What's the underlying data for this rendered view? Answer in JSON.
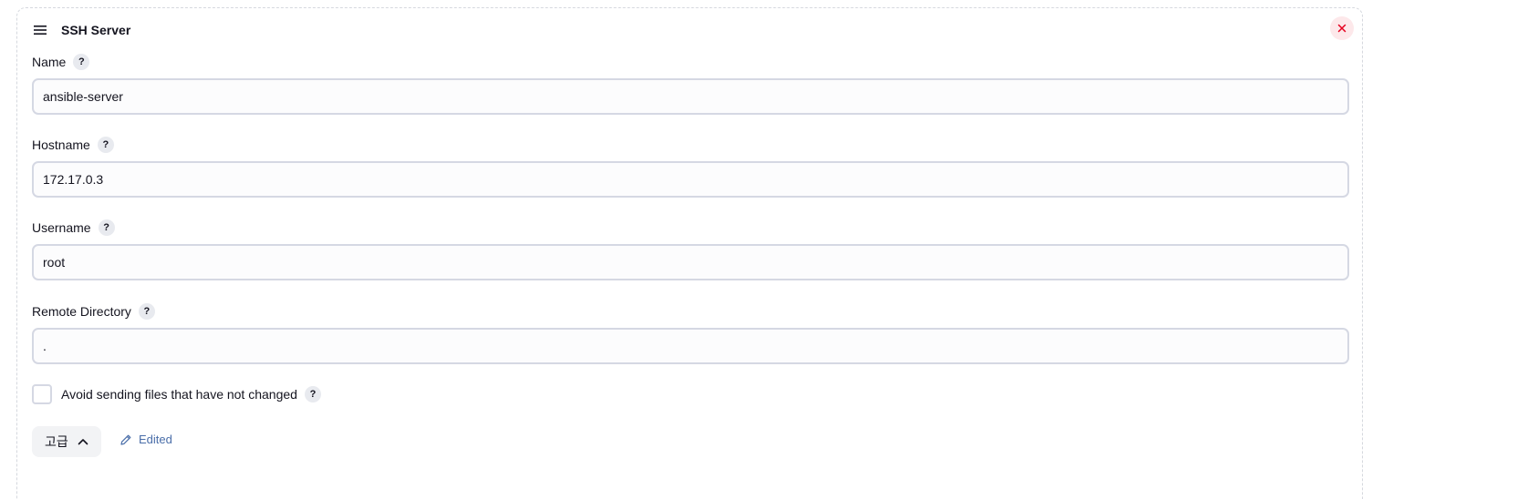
{
  "panel": {
    "title": "SSH Server",
    "handle_icon": "drag-handle-icon",
    "close_icon": "close-icon"
  },
  "fields": {
    "name": {
      "label": "Name",
      "value": "ansible-server"
    },
    "hostname": {
      "label": "Hostname",
      "value": "172.17.0.3"
    },
    "username": {
      "label": "Username",
      "value": "root"
    },
    "remote_directory": {
      "label": "Remote Directory",
      "value": "."
    }
  },
  "help_label": "?",
  "checkbox": {
    "label": "Avoid sending files that have not changed",
    "checked": false
  },
  "advanced": {
    "label": "고급",
    "icon": "chevron-up-icon"
  },
  "edited": {
    "label": "Edited",
    "icon": "pencil-icon"
  },
  "colors": {
    "close_bg": "#fde8ea",
    "close_fg": "#e6001f",
    "edited_link": "#4a6ea9"
  }
}
